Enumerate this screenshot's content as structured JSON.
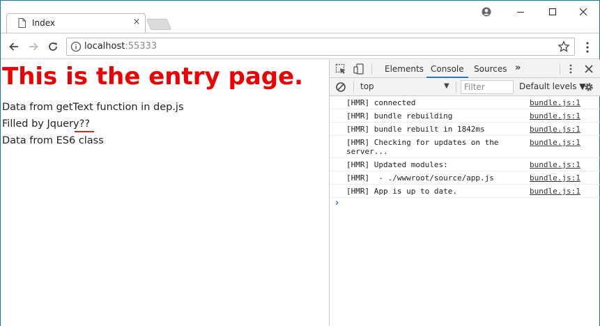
{
  "tab": {
    "title": "Index",
    "close": "×"
  },
  "window_controls": {
    "minimize": "—",
    "maximize": "☐",
    "close": "✕"
  },
  "address": {
    "host": "localhost",
    "port": ":55333"
  },
  "page": {
    "heading": "This is the entry page.",
    "lines": [
      "Data from getText function in dep.js",
      "Filled by Jquery??",
      "Data from ES6 class"
    ]
  },
  "devtools": {
    "tabs": [
      "Elements",
      "Console",
      "Sources"
    ],
    "active_tab": "Console",
    "more": "»",
    "context": "top",
    "filter_placeholder": "Filter",
    "levels": "Default levels",
    "messages": [
      {
        "text": "[HMR] connected",
        "source": "bundle.js:1"
      },
      {
        "text": "[HMR] bundle rebuilding",
        "source": "bundle.js:1"
      },
      {
        "text": "[HMR] bundle rebuilt in 1842ms",
        "source": "bundle.js:1"
      },
      {
        "text": "[HMR] Checking for updates on the server...",
        "source": "bundle.js:1"
      },
      {
        "text": "[HMR] Updated modules:",
        "source": "bundle.js:1"
      },
      {
        "text": "[HMR]  - ./wwwroot/source/app.js",
        "source": "bundle.js:1"
      },
      {
        "text": "[HMR] App is up to date.",
        "source": "bundle.js:1"
      }
    ],
    "prompt": "›"
  },
  "colors": {
    "heading": "#ee0000",
    "accent": "#1a73e8",
    "border": "#1a73b8"
  },
  "icons": [
    "page-icon",
    "account-icon",
    "back-icon",
    "forward-icon",
    "reload-icon",
    "info-icon",
    "star-icon",
    "menu-icon",
    "inspect-icon",
    "device-icon",
    "clear-icon",
    "gear-icon"
  ]
}
